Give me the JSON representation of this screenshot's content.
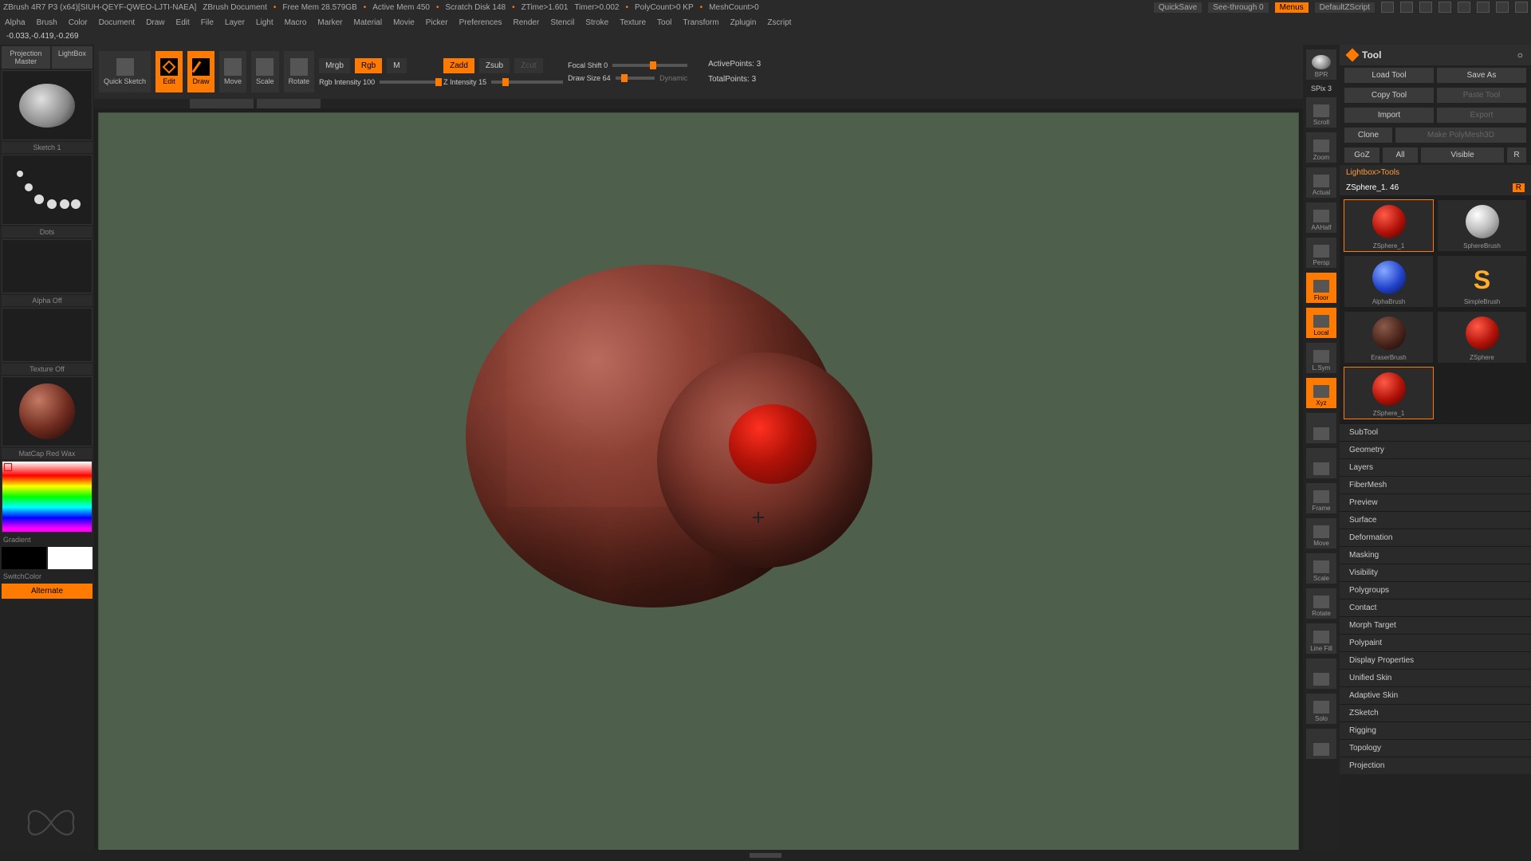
{
  "title": {
    "app": "ZBrush 4R7 P3 (x64)[SIUH-QEYF-QWEO-LJTI-NAEA]",
    "doc": "ZBrush Document",
    "freemem": "Free Mem 28.579GB",
    "activemem": "Active Mem 450",
    "scratch": "Scratch Disk 148",
    "ztime": "ZTime>1.601",
    "timer": "Timer>0.002",
    "polycount": "PolyCount>0 KP",
    "meshcount": "MeshCount>0",
    "quicksave": "QuickSave",
    "seethrough": "See-through   0",
    "menus": "Menus",
    "cfg": "DefaultZScript"
  },
  "menu": [
    "Alpha",
    "Brush",
    "Color",
    "Document",
    "Draw",
    "Edit",
    "File",
    "Layer",
    "Light",
    "Macro",
    "Marker",
    "Material",
    "Movie",
    "Picker",
    "Preferences",
    "Render",
    "Stencil",
    "Stroke",
    "Texture",
    "Tool",
    "Transform",
    "Zplugin",
    "Zscript"
  ],
  "coord": "-0.033,-0.419,-0.269",
  "left": {
    "projection": "Projection Master",
    "lightbox": "LightBox",
    "sketch1": "Sketch 1",
    "dots": "Dots",
    "alpha_off": "Alpha Off",
    "texture_off": "Texture Off",
    "matcap": "MatCap Red Wax",
    "gradient": "Gradient",
    "switchcolor": "SwitchColor",
    "alternate": "Alternate"
  },
  "shelf": {
    "quicksketch": "Quick Sketch",
    "edit": "Edit",
    "draw": "Draw",
    "move": "Move",
    "scale": "Scale",
    "rotate": "Rotate",
    "mrgb": "Mrgb",
    "rgb": "Rgb",
    "m": "M",
    "rgbint": "Rgb Intensity 100",
    "zadd": "Zadd",
    "zsub": "Zsub",
    "zcut": "Zcut",
    "zint": "Z Intensity 15",
    "focal": "Focal Shift 0",
    "drawsize": "Draw Size 64",
    "dynamic": "Dynamic",
    "activepoints": "ActivePoints: 3",
    "totalpoints": "TotalPoints: 3"
  },
  "vstrip": {
    "bpr": "BPR",
    "spix": "SPix 3",
    "items": [
      "Scroll",
      "Zoom",
      "Actual",
      "AAHalf",
      "Persp",
      "Floor",
      "Local",
      "L.Sym",
      "Xyz",
      "",
      "",
      "Frame",
      "Move",
      "Scale",
      "Rotate",
      "Line Fill",
      "",
      "Solo",
      ""
    ],
    "on": {
      "Floor": true,
      "Local": true,
      "Xyz": true
    }
  },
  "tool": {
    "header": "Tool",
    "load": "Load Tool",
    "save": "Save As",
    "copy": "Copy Tool",
    "paste": "Paste Tool",
    "import": "Import",
    "export": "Export",
    "clone": "Clone",
    "makepm": "Make PolyMesh3D",
    "goz": "GoZ",
    "all": "All",
    "visible": "Visible",
    "r": "R",
    "lbtools": "Lightbox>Tools",
    "active": "ZSphere_1. 46",
    "active_r": "R",
    "thumbs": [
      {
        "name": "ZSphere_1",
        "ball": "red-ball",
        "sel": true
      },
      {
        "name": "SphereBrush",
        "ball": "grey-ball"
      },
      {
        "name": "AlphaBrush",
        "ball": "blue-ball"
      },
      {
        "name": "SimpleBrush",
        "ball": "gold-s"
      },
      {
        "name": "EraserBrush",
        "ball": "dark-ball"
      },
      {
        "name": "ZSphere",
        "ball": "red-ball"
      },
      {
        "name": "ZSphere_1",
        "ball": "red-ball",
        "sel": true
      }
    ],
    "sections": [
      "SubTool",
      "Geometry",
      "Layers",
      "FiberMesh",
      "Preview",
      "Surface",
      "Deformation",
      "Masking",
      "Visibility",
      "Polygroups",
      "Contact",
      "Morph Target",
      "Polypaint",
      "Display Properties",
      "Unified Skin",
      "Adaptive Skin",
      "ZSketch",
      "Rigging",
      "Topology",
      "Projection"
    ]
  }
}
